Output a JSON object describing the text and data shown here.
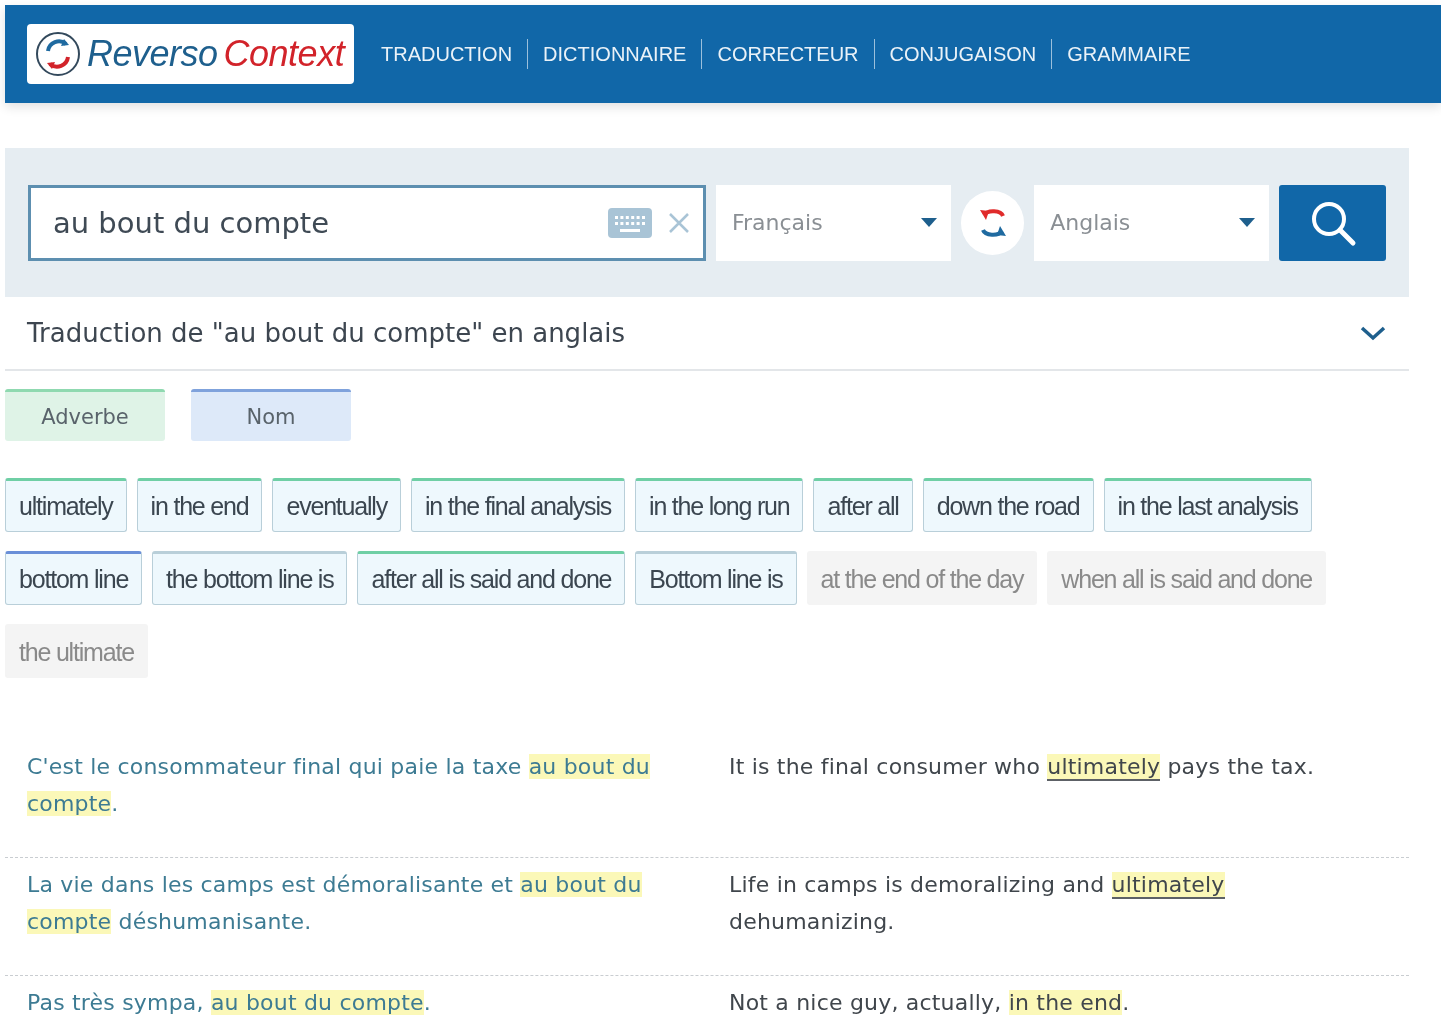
{
  "header": {
    "logo": {
      "word_1": "Reverso",
      "word_2": "Context"
    },
    "nav": [
      "TRADUCTION",
      "DICTIONNAIRE",
      "CORRECTEUR",
      "CONJUGAISON",
      "GRAMMAIRE"
    ]
  },
  "search": {
    "value": "au bout du compte",
    "source_language": "Français",
    "target_language": "Anglais"
  },
  "result_heading": {
    "title": "Traduction de \"au bout du compte\" en anglais",
    "expanded": true
  },
  "categories": [
    {
      "label": "Adverbe",
      "kind": "adverb"
    },
    {
      "label": "Nom",
      "kind": "noun"
    }
  ],
  "translations": [
    {
      "text": "ultimately",
      "kind": "adverb"
    },
    {
      "text": "in the end",
      "kind": "adverb"
    },
    {
      "text": "eventually",
      "kind": "adverb"
    },
    {
      "text": "in the final analysis",
      "kind": "adverb"
    },
    {
      "text": "in the long run",
      "kind": "adverb"
    },
    {
      "text": "after all",
      "kind": "adverb"
    },
    {
      "text": "down the road",
      "kind": "adverb"
    },
    {
      "text": "in the last analysis",
      "kind": "adverb"
    },
    {
      "text": "bottom line",
      "kind": "noun"
    },
    {
      "text": "the bottom line is",
      "kind": "plain"
    },
    {
      "text": "after all is said and done",
      "kind": "adverb"
    },
    {
      "text": "Bottom line is",
      "kind": "plain"
    },
    {
      "text": "at the end of the day",
      "kind": "rare"
    },
    {
      "text": "when all is said and done",
      "kind": "rare"
    },
    {
      "text": "the ultimate",
      "kind": "rare"
    }
  ],
  "examples": [
    {
      "source": [
        {
          "text": "C'est le consommateur final qui paie la taxe ",
          "highlighted": false
        },
        {
          "text": "au bout du compte",
          "highlighted": true
        },
        {
          "text": ".",
          "highlighted": false
        }
      ],
      "target": [
        {
          "text": "It is the final consumer who ",
          "highlighted": false,
          "underlined": false
        },
        {
          "text": "ultimately",
          "highlighted": true,
          "underlined": true
        },
        {
          "text": " pays the tax.",
          "highlighted": false,
          "underlined": false
        }
      ]
    },
    {
      "source": [
        {
          "text": "La vie dans les camps est démoralisante et ",
          "highlighted": false
        },
        {
          "text": "au bout du compte",
          "highlighted": true
        },
        {
          "text": " déshumanisante.",
          "highlighted": false
        }
      ],
      "target": [
        {
          "text": "Life in camps is demoralizing and ",
          "highlighted": false,
          "underlined": false
        },
        {
          "text": "ultimately",
          "highlighted": true,
          "underlined": true
        },
        {
          "text": " dehumanizing.",
          "highlighted": false,
          "underlined": false
        }
      ]
    },
    {
      "source": [
        {
          "text": "Pas très sympa, ",
          "highlighted": false
        },
        {
          "text": "au bout du compte",
          "highlighted": true
        },
        {
          "text": ".",
          "highlighted": false
        }
      ],
      "target": [
        {
          "text": "Not a nice guy, actually, ",
          "highlighted": false,
          "underlined": false
        },
        {
          "text": "in the end",
          "highlighted": true,
          "underlined": false
        },
        {
          "text": ".",
          "highlighted": false,
          "underlined": false
        }
      ]
    }
  ]
}
